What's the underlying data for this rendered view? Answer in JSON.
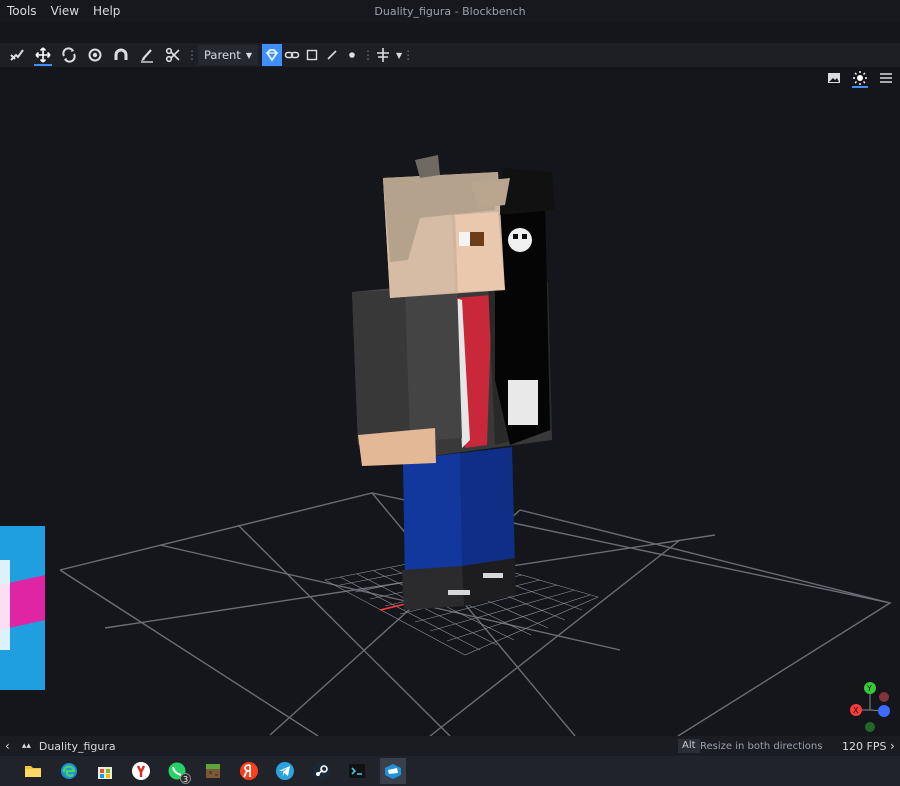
{
  "window": {
    "title": "Duality_figura - Blockbench"
  },
  "menubar": {
    "items": [
      "Tools",
      "View",
      "Help"
    ]
  },
  "toolbar": {
    "tools": [
      {
        "name": "vertex-snap-icon"
      },
      {
        "name": "move-tool-icon"
      },
      {
        "name": "rotate-tool-icon"
      },
      {
        "name": "pivot-tool-icon"
      },
      {
        "name": "vertex-snap-magnet-icon"
      },
      {
        "name": "paint-brush-icon"
      },
      {
        "name": "scissors-icon"
      }
    ],
    "transform_space": "Parent"
  },
  "viewport": {
    "scene": "3D minecraft character model on grid floor",
    "colors": {
      "bg": "#15161b",
      "grid": "#6a6d75",
      "x_axis": "#ff3b3b",
      "y_axis": "#33cc33",
      "z_axis": "#3b6bff"
    },
    "gizmo": {
      "x": "X",
      "y": "Y"
    }
  },
  "statusbar": {
    "project_name": "Duality_figura",
    "key_hint": "Alt",
    "hint_text": "Resize in both directions",
    "fps": "120 FPS"
  },
  "taskbar": {
    "apps": [
      "file-explorer-icon",
      "edge-icon",
      "microsoft-store-icon",
      "yandex-browser-icon",
      "whatsapp-icon",
      "minecraft-icon",
      "yandex-icon",
      "telegram-icon",
      "steam-icon",
      "terminal-icon",
      "blockbench-icon"
    ],
    "whatsapp_badge": "3"
  }
}
